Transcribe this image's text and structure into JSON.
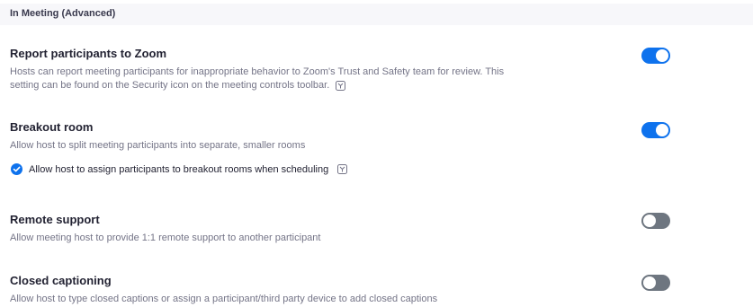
{
  "section": {
    "title": "In Meeting (Advanced)"
  },
  "settings": [
    {
      "title": "Report participants to Zoom",
      "description_line1": "Hosts can report meeting participants for inappropriate behavior to Zoom's Trust and Safety team for review. This",
      "description_line2": "setting can be found on the Security icon on the meeting controls toolbar.",
      "enabled": true
    },
    {
      "title": "Breakout room",
      "description": "Allow host to split meeting participants into separate, smaller rooms",
      "enabled": true,
      "sub_option": {
        "label": "Allow host to assign participants to breakout rooms when scheduling",
        "checked": true
      }
    },
    {
      "title": "Remote support",
      "description": "Allow meeting host to provide 1:1 remote support to another participant",
      "enabled": false
    },
    {
      "title": "Closed captioning",
      "description": "Allow host to type closed captions or assign a participant/third party device to add closed captions",
      "enabled": false
    }
  ],
  "colors": {
    "accent": "#0e72ed",
    "toggle_off": "#6e7680",
    "header_bg": "#f7f7fa"
  },
  "icons": {
    "info": "info-icon",
    "check": "check-icon"
  }
}
